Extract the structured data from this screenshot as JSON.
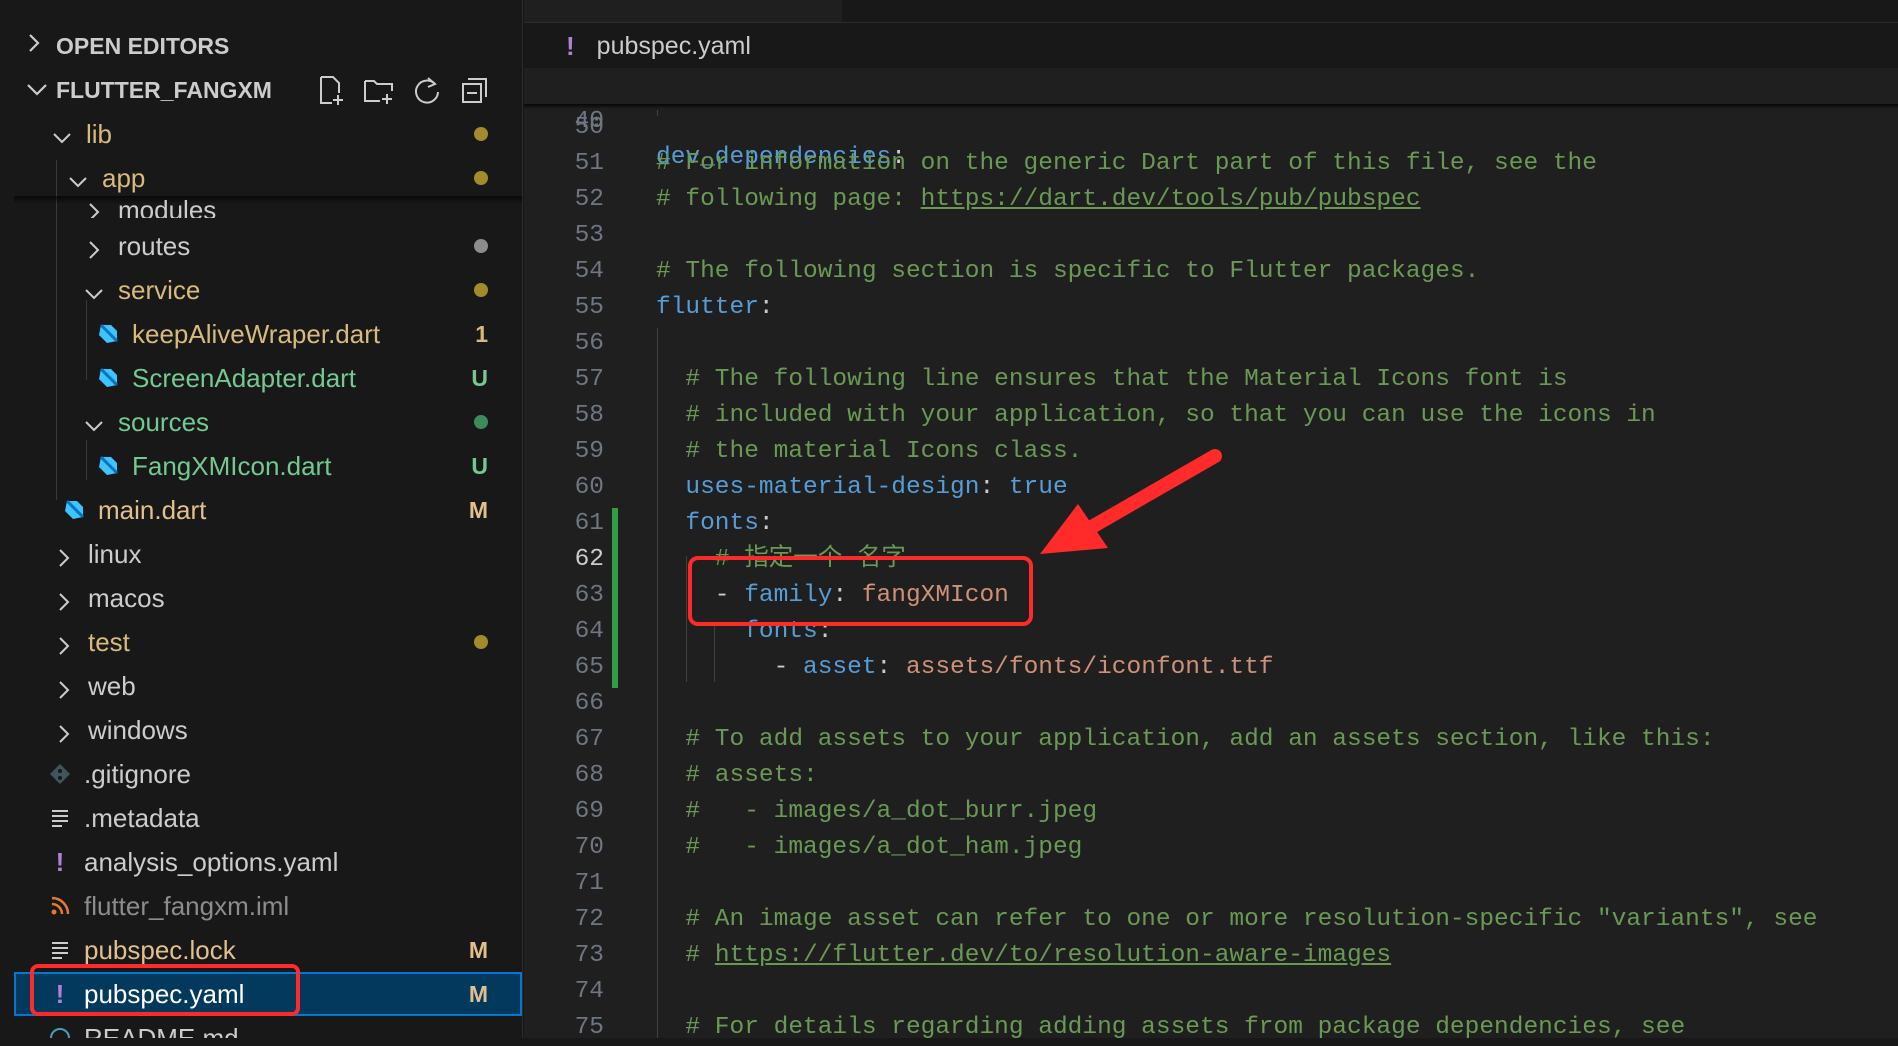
{
  "explorer": {
    "open_editors_label": "OPEN EDITORS",
    "project_label": "FLUTTER_FANGXM",
    "actions": [
      "new-file-icon",
      "new-folder-icon",
      "refresh-icon",
      "collapse-all-icon"
    ],
    "items": [
      {
        "name": "lib",
        "badge": "",
        "dot": "#a28b2c",
        "color": "#d7ba7d"
      },
      {
        "name": "app",
        "badge": "",
        "dot": "#a28b2c",
        "color": "#d7ba7d"
      },
      {
        "name": "modules",
        "badge": "",
        "dot": "#8c8c8c",
        "color": "#cccccc"
      },
      {
        "name": "routes",
        "badge": "",
        "dot": "#8c8c8c",
        "color": "#cccccc"
      },
      {
        "name": "service",
        "badge": "",
        "dot": "#a28b2c",
        "color": "#d7ba7d"
      },
      {
        "name": "keepAliveWraper.dart",
        "badge": "1",
        "color": "#d7ba7d"
      },
      {
        "name": "ScreenAdapter.dart",
        "badge": "U",
        "color": "#73c991"
      },
      {
        "name": "sources",
        "badge": "",
        "dot": "#3e8a5b",
        "color": "#73c991"
      },
      {
        "name": "FangXMIcon.dart",
        "badge": "U",
        "color": "#73c991"
      },
      {
        "name": "main.dart",
        "badge": "M",
        "color": "#e2c08d"
      },
      {
        "name": "linux",
        "badge": "",
        "color": "#cccccc"
      },
      {
        "name": "macos",
        "badge": "",
        "color": "#cccccc"
      },
      {
        "name": "test",
        "badge": "",
        "dot": "#a28b2c",
        "color": "#d7ba7d"
      },
      {
        "name": "web",
        "badge": "",
        "color": "#cccccc"
      },
      {
        "name": "windows",
        "badge": "",
        "color": "#cccccc"
      },
      {
        "name": ".gitignore",
        "badge": "",
        "color": "#cccccc"
      },
      {
        "name": ".metadata",
        "badge": "",
        "color": "#cccccc"
      },
      {
        "name": "analysis_options.yaml",
        "badge": "",
        "color": "#cccccc"
      },
      {
        "name": "flutter_fangxm.iml",
        "badge": "",
        "color": "#8c8c8c"
      },
      {
        "name": "pubspec.lock",
        "badge": "M",
        "color": "#e2c08d"
      },
      {
        "name": "pubspec.yaml",
        "badge": "M",
        "color": "#ffffff"
      },
      {
        "name": "README.md",
        "badge": "",
        "color": "#cccccc"
      }
    ]
  },
  "editor": {
    "breadcrumb_file": "pubspec.yaml",
    "breadcrumb_mark": "!",
    "sticky": {
      "num": "40",
      "key": "dev_dependencies",
      "rest": ":"
    },
    "lines": [
      {
        "num": "50",
        "text": ""
      },
      {
        "num": "51",
        "text": "# For information on the generic Dart part of this file, see the"
      },
      {
        "num": "52",
        "text": "# following page: ",
        "link": "https://dart.dev/tools/pub/pubspec"
      },
      {
        "num": "53",
        "text": ""
      },
      {
        "num": "54",
        "text": "# The following section is specific to Flutter packages."
      },
      {
        "num": "55",
        "key": "flutter",
        "rest": ":"
      },
      {
        "num": "56",
        "text": ""
      },
      {
        "num": "57",
        "text": "  # The following line ensures that the Material Icons font is"
      },
      {
        "num": "58",
        "text": "  # included with your application, so that you can use the icons in"
      },
      {
        "num": "59",
        "text": "  # the material Icons class."
      },
      {
        "num": "60",
        "key": "  uses-material-design",
        "rest": ": ",
        "value": "true"
      },
      {
        "num": "61",
        "key": "  fonts",
        "rest": ":"
      },
      {
        "num": "62",
        "text": "    # 指定一个 名字"
      },
      {
        "num": "63",
        "dash": "    - ",
        "key": "family",
        "rest": ": ",
        "value": "fangXMIcon"
      },
      {
        "num": "64",
        "key": "      fonts",
        "rest": ":"
      },
      {
        "num": "65",
        "dash": "        - ",
        "key": "asset",
        "rest": ": ",
        "value": "assets/fonts/iconfont.ttf"
      },
      {
        "num": "66",
        "text": ""
      },
      {
        "num": "67",
        "text": "  # To add assets to your application, add an assets section, like this:"
      },
      {
        "num": "68",
        "text": "  # assets:"
      },
      {
        "num": "69",
        "text": "  #   - images/a_dot_burr.jpeg"
      },
      {
        "num": "70",
        "text": "  #   - images/a_dot_ham.jpeg"
      },
      {
        "num": "71",
        "text": ""
      },
      {
        "num": "72",
        "text": "  # An image asset can refer to one or more resolution-specific \"variants\", see"
      },
      {
        "num": "73",
        "text": "  # ",
        "link": "https://flutter.dev/to/resolution-aware-images"
      },
      {
        "num": "74",
        "text": ""
      },
      {
        "num": "75",
        "text": "  # For details regarding adding assets from package dependencies, see"
      }
    ]
  },
  "annotations": {
    "highlight_color": "#ff2a2a"
  }
}
